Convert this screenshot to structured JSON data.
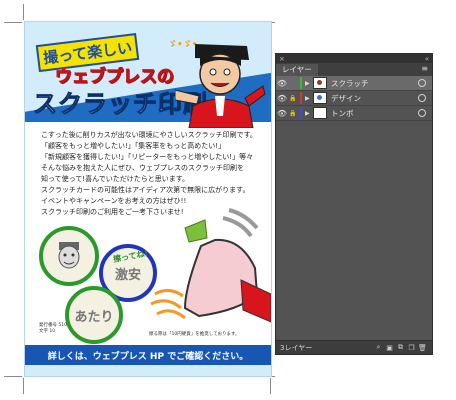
{
  "flyer": {
    "headline_1": "撮って楽しい",
    "headline_2": "ウェブプレスの",
    "headline_3": "スクラッチ印刷",
    "sparkle": "ゞ•ゞ•",
    "body_lines": [
      "こすった後に削りカスが出ない環境にやさしいスクラッチ印刷です。",
      "「顧客をもっと増やしたい!」「集客率をもっと高めたい!」",
      "「新規顧客を獲得したい!」「リピーターをもっと増やしたい!」等々",
      "そんな悩みを抱えた人にぜひ、ウェブプレスのスクラッチ印刷を",
      "知って使って!喜んでいただけたらと思います。",
      "スクラッチカードの可能性はアイディア次第で無限に広がります。",
      "イベントやキャンペーンをお考えの方はぜひ!!",
      "スクラッチ印刷のご利用をご一考下さいませ!"
    ],
    "kite_label": "擦ってね!",
    "circle_labels": [
      "",
      "激安",
      "あたり"
    ],
    "note_left_1": "発行番号 510",
    "note_left_2": "文字 10",
    "note_right": "擦る際は「10円硬貨」を推奨しております。",
    "bottom_banner": "詳しくは、ウェブプレス HP でご確認ください。"
  },
  "panel": {
    "collapse_icon": "×",
    "expand_icon": "«",
    "tab_label": "レイヤー",
    "menu_icon": "≡",
    "layers": [
      {
        "name": "スクラッチ",
        "visible": true,
        "locked": false,
        "color": "#2fbf3f",
        "selected": true
      },
      {
        "name": "デザイン",
        "visible": true,
        "locked": true,
        "color": "#d23a3a",
        "selected": false
      },
      {
        "name": "トンボ",
        "visible": true,
        "locked": true,
        "color": "#3a4fd2",
        "selected": false
      }
    ],
    "layer_count_label": "3レイヤー",
    "eye_glyph": "👁",
    "lock_glyph": "🔒",
    "footer_icons": [
      "search-icon",
      "make-clipping-mask-icon",
      "new-sublayer-icon",
      "new-layer-icon",
      "delete-icon"
    ]
  }
}
